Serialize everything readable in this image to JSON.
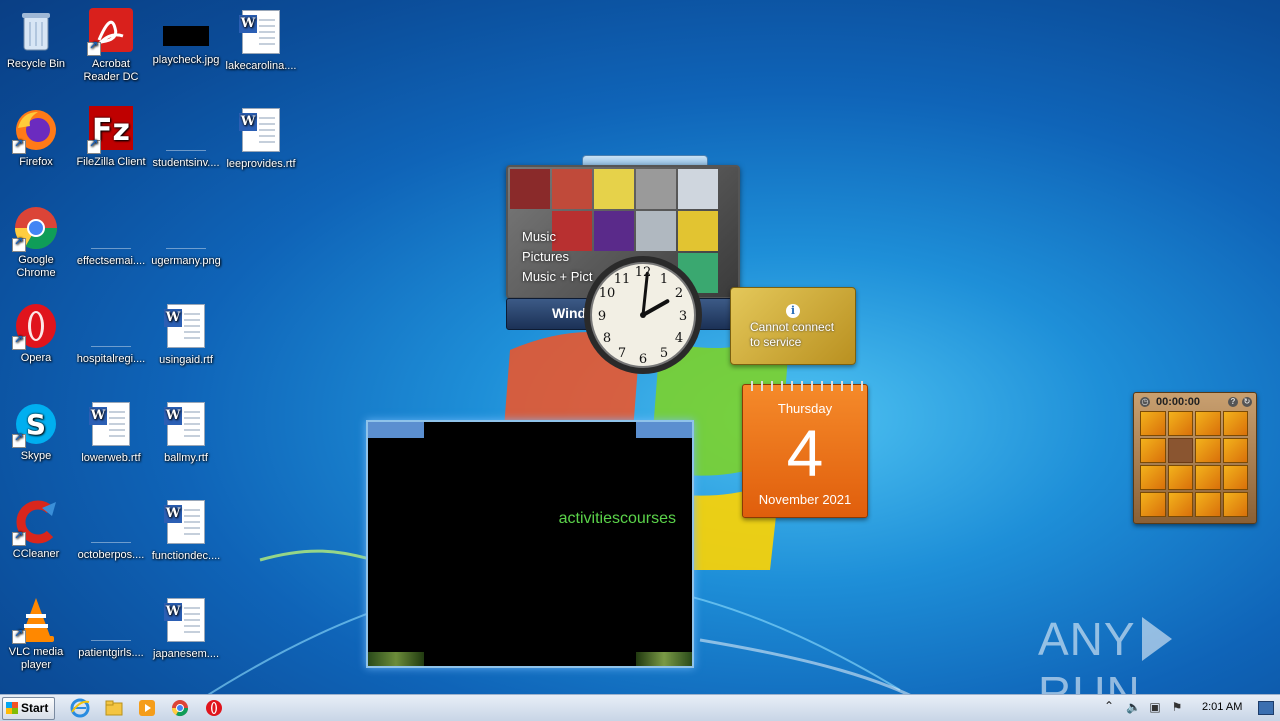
{
  "desktop": {
    "icons": [
      {
        "label": "Recycle Bin",
        "icon": "recycle-bin-icon"
      },
      {
        "label": "Acrobat Reader DC",
        "icon": "acrobat-reader-icon"
      },
      {
        "label": "playcheck.jpg",
        "icon": "image-file-icon"
      },
      {
        "label": "lakecarolina....",
        "icon": "word-document-icon"
      },
      {
        "label": "Firefox",
        "icon": "firefox-icon"
      },
      {
        "label": "FileZilla Client",
        "icon": "filezilla-icon"
      },
      {
        "label": "studentsinv....",
        "icon": "blank-file-icon"
      },
      {
        "label": "leeprovides.rtf",
        "icon": "word-document-icon"
      },
      {
        "label": "Google Chrome",
        "icon": "chrome-icon"
      },
      {
        "label": "effectsemai....",
        "icon": "blank-file-icon"
      },
      {
        "label": "ugermany.png",
        "icon": "blank-file-icon"
      },
      {
        "label": "Opera",
        "icon": "opera-icon"
      },
      {
        "label": "hospitalregi....",
        "icon": "blank-file-icon"
      },
      {
        "label": "usingaid.rtf",
        "icon": "word-document-icon"
      },
      {
        "label": "Skype",
        "icon": "skype-icon"
      },
      {
        "label": "lowerweb.rtf",
        "icon": "word-document-icon"
      },
      {
        "label": "ballmy.rtf",
        "icon": "word-document-icon"
      },
      {
        "label": "CCleaner",
        "icon": "ccleaner-icon"
      },
      {
        "label": "octoberpos....",
        "icon": "blank-file-icon"
      },
      {
        "label": "functiondec....",
        "icon": "word-document-icon"
      },
      {
        "label": "VLC media player",
        "icon": "vlc-icon"
      },
      {
        "label": "patientgirls....",
        "icon": "blank-file-icon"
      },
      {
        "label": "japanesem....",
        "icon": "word-document-icon"
      }
    ]
  },
  "gadgets": {
    "media_center": {
      "menu": [
        "Music",
        "Pictures",
        "Music + Pict"
      ],
      "bar_label": "Wind"
    },
    "news_feed": {
      "message_line1": "Cannot connect",
      "message_line2": "to service",
      "info_glyph": "i"
    },
    "calendar": {
      "weekday": "Thursday",
      "day": "4",
      "month_year": "November 2021"
    },
    "slideshow": {
      "caption": "activitiescourses"
    },
    "clock": {
      "hour": 2,
      "minute": 1
    },
    "puzzle": {
      "timer": "00:00:00"
    }
  },
  "watermark": {
    "left": "ANY",
    "right": "RUN"
  },
  "taskbar": {
    "start_label": "Start",
    "pinned": [
      "internet-explorer-icon",
      "file-explorer-icon",
      "media-player-icon",
      "chrome-icon",
      "opera-icon"
    ],
    "tray_time": "2:01 AM"
  }
}
